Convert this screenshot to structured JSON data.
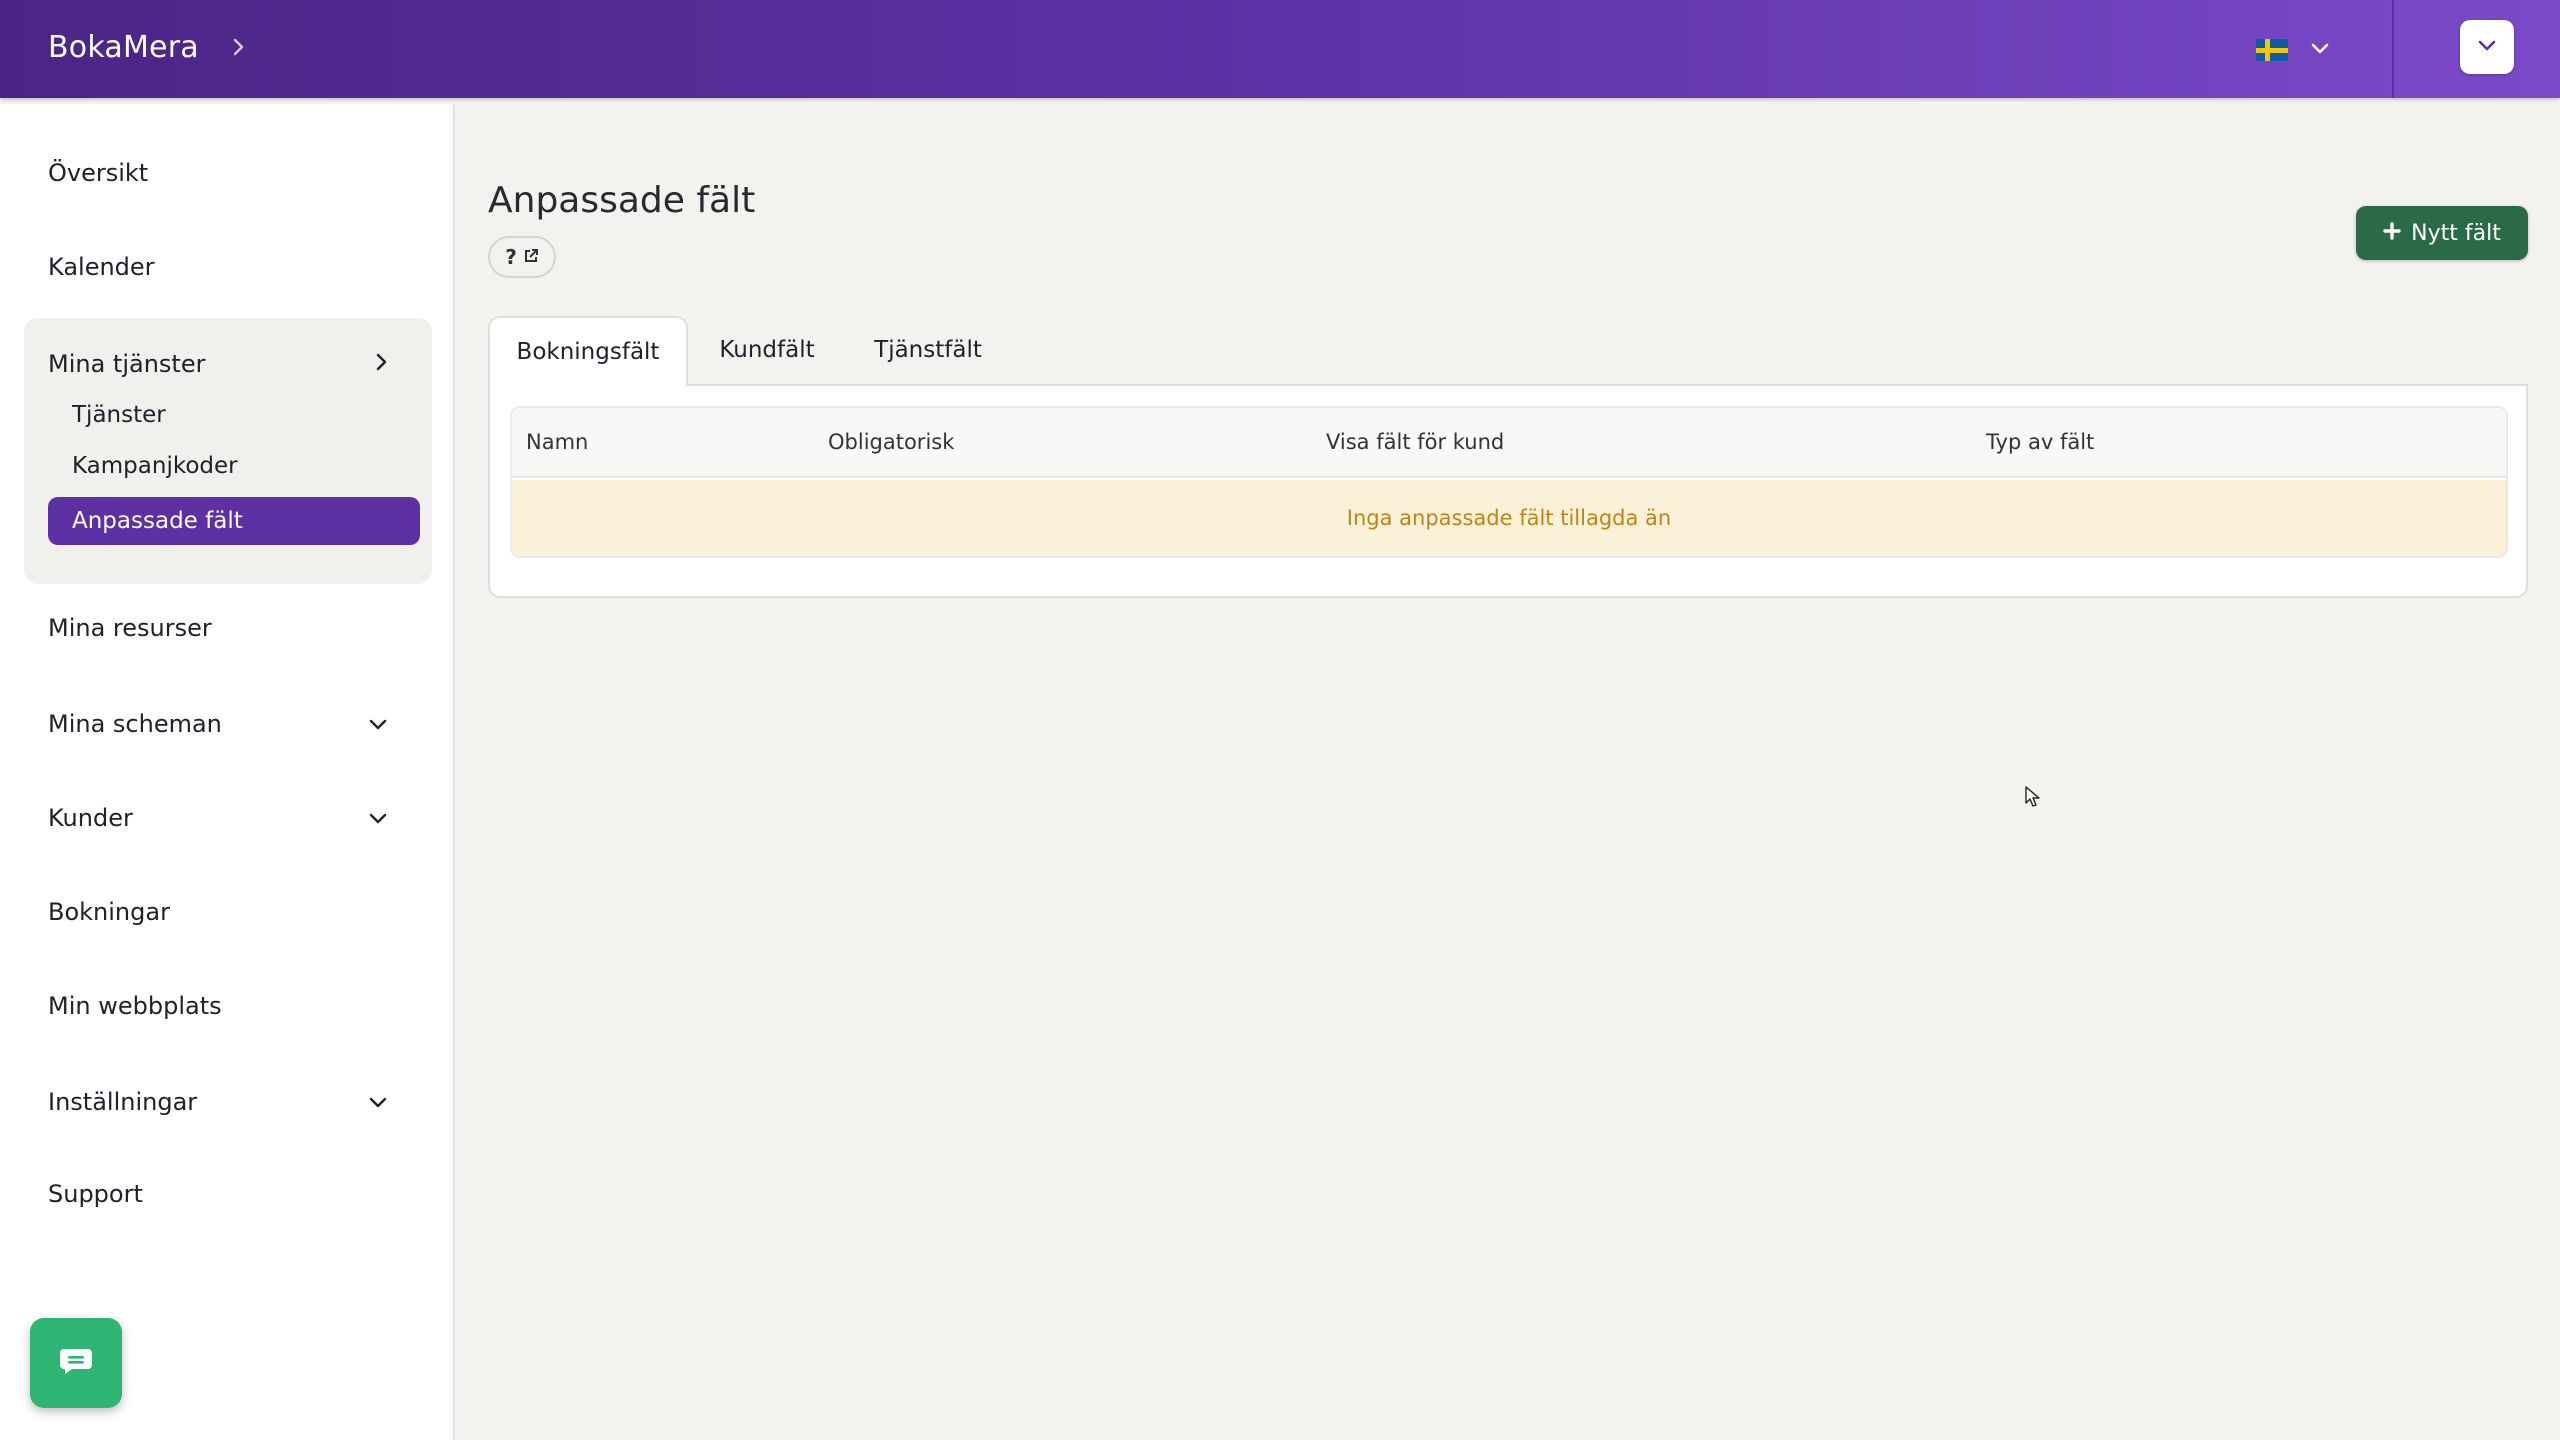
{
  "header": {
    "brand": "BokaMera",
    "language_flag": "sweden-flag"
  },
  "sidebar": {
    "items": [
      {
        "label": "Översikt"
      },
      {
        "label": "Kalender"
      },
      {
        "label": "Mina tjänster"
      },
      {
        "label": "Mina resurser"
      },
      {
        "label": "Mina scheman"
      },
      {
        "label": "Kunder"
      },
      {
        "label": "Bokningar"
      },
      {
        "label": "Min webbplats"
      },
      {
        "label": "Inställningar"
      },
      {
        "label": "Support"
      }
    ],
    "sub_items": [
      {
        "label": "Tjänster"
      },
      {
        "label": "Kampanjkoder"
      },
      {
        "label": "Anpassade fält",
        "active": true
      }
    ]
  },
  "main": {
    "title": "Anpassade fält",
    "help_label": "?",
    "new_button_label": "Nytt fält",
    "tabs": [
      {
        "label": "Bokningsfält",
        "active": true
      },
      {
        "label": "Kundfält"
      },
      {
        "label": "Tjänstfält"
      }
    ],
    "table": {
      "columns": [
        "Namn",
        "Obligatorisk",
        "Visa fält för kund",
        "Typ av fält"
      ],
      "empty_message": "Inga anpassade fält tillagda än"
    }
  },
  "colors": {
    "header_gradient_start": "#4b2585",
    "header_gradient_end": "#7b4ac9",
    "active_nav": "#5d30a3",
    "primary_button": "#2b6a46",
    "empty_row_bg": "#fbf1d8",
    "empty_row_text": "#c08416",
    "chat_button": "#2fb573"
  }
}
